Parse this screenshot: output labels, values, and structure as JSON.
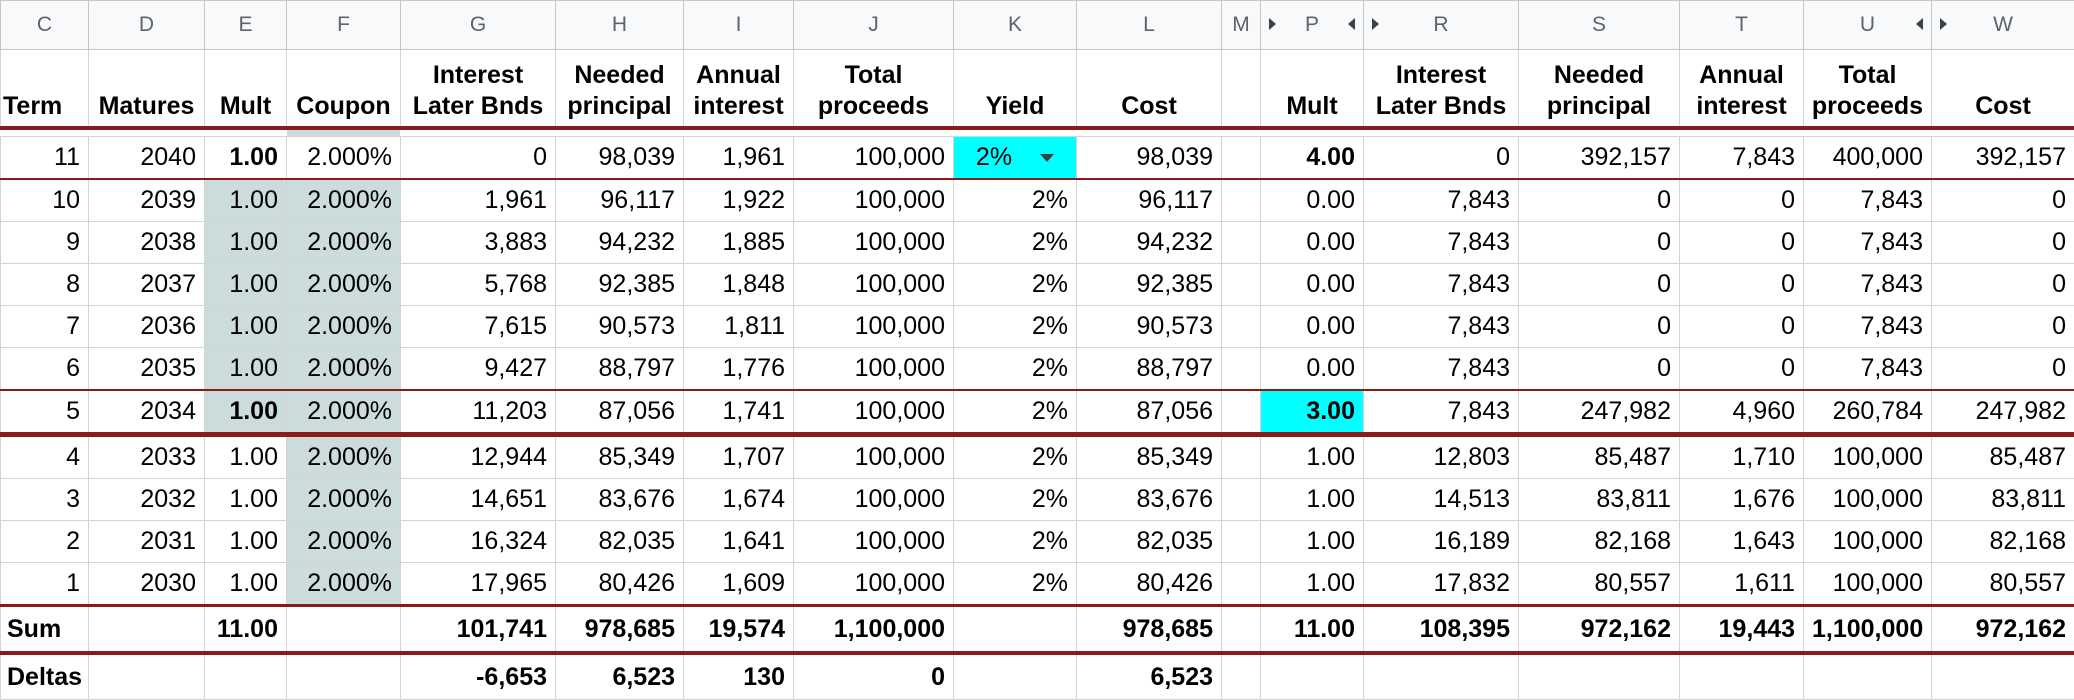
{
  "columns": [
    "C",
    "D",
    "E",
    "F",
    "G",
    "H",
    "I",
    "J",
    "K",
    "L",
    "M",
    "P",
    "R",
    "S",
    "T",
    "U",
    "W"
  ],
  "headers": {
    "term": "Term",
    "matures": "Matures",
    "mult": "Mult",
    "coupon": "Coupon",
    "interest_later": "Interest Later Bnds",
    "needed_principal": "Needed principal",
    "annual_interest": "Annual interest",
    "total_proceeds": "Total proceeds",
    "yield": "Yield",
    "cost": "Cost",
    "mult2": "Mult",
    "interest_later2": "Interest Later Bnds",
    "needed_principal2": "Needed principal",
    "annual_interest2": "Annual interest",
    "total_proceeds2": "Total proceeds",
    "cost2": "Cost"
  },
  "rows": [
    {
      "term": "11",
      "matures": "2040",
      "mult": "1.00",
      "coupon": "2.000%",
      "g": "0",
      "h": "98,039",
      "i": "1,961",
      "j": "100,000",
      "yield": "2%",
      "l": "98,039",
      "p": "4.00",
      "r": "0",
      "s": "392,157",
      "t": "7,843",
      "u": "400,000",
      "w": "392,157"
    },
    {
      "term": "10",
      "matures": "2039",
      "mult": "1.00",
      "coupon": "2.000%",
      "g": "1,961",
      "h": "96,117",
      "i": "1,922",
      "j": "100,000",
      "yield": "2%",
      "l": "96,117",
      "p": "0.00",
      "r": "7,843",
      "s": "0",
      "t": "0",
      "u": "7,843",
      "w": "0"
    },
    {
      "term": "9",
      "matures": "2038",
      "mult": "1.00",
      "coupon": "2.000%",
      "g": "3,883",
      "h": "94,232",
      "i": "1,885",
      "j": "100,000",
      "yield": "2%",
      "l": "94,232",
      "p": "0.00",
      "r": "7,843",
      "s": "0",
      "t": "0",
      "u": "7,843",
      "w": "0"
    },
    {
      "term": "8",
      "matures": "2037",
      "mult": "1.00",
      "coupon": "2.000%",
      "g": "5,768",
      "h": "92,385",
      "i": "1,848",
      "j": "100,000",
      "yield": "2%",
      "l": "92,385",
      "p": "0.00",
      "r": "7,843",
      "s": "0",
      "t": "0",
      "u": "7,843",
      "w": "0"
    },
    {
      "term": "7",
      "matures": "2036",
      "mult": "1.00",
      "coupon": "2.000%",
      "g": "7,615",
      "h": "90,573",
      "i": "1,811",
      "j": "100,000",
      "yield": "2%",
      "l": "90,573",
      "p": "0.00",
      "r": "7,843",
      "s": "0",
      "t": "0",
      "u": "7,843",
      "w": "0"
    },
    {
      "term": "6",
      "matures": "2035",
      "mult": "1.00",
      "coupon": "2.000%",
      "g": "9,427",
      "h": "88,797",
      "i": "1,776",
      "j": "100,000",
      "yield": "2%",
      "l": "88,797",
      "p": "0.00",
      "r": "7,843",
      "s": "0",
      "t": "0",
      "u": "7,843",
      "w": "0"
    },
    {
      "term": "5",
      "matures": "2034",
      "mult": "1.00",
      "coupon": "2.000%",
      "g": "11,203",
      "h": "87,056",
      "i": "1,741",
      "j": "100,000",
      "yield": "2%",
      "l": "87,056",
      "p": "3.00",
      "r": "7,843",
      "s": "247,982",
      "t": "4,960",
      "u": "260,784",
      "w": "247,982"
    },
    {
      "term": "4",
      "matures": "2033",
      "mult": "1.00",
      "coupon": "2.000%",
      "g": "12,944",
      "h": "85,349",
      "i": "1,707",
      "j": "100,000",
      "yield": "2%",
      "l": "85,349",
      "p": "1.00",
      "r": "12,803",
      "s": "85,487",
      "t": "1,710",
      "u": "100,000",
      "w": "85,487"
    },
    {
      "term": "3",
      "matures": "2032",
      "mult": "1.00",
      "coupon": "2.000%",
      "g": "14,651",
      "h": "83,676",
      "i": "1,674",
      "j": "100,000",
      "yield": "2%",
      "l": "83,676",
      "p": "1.00",
      "r": "14,513",
      "s": "83,811",
      "t": "1,676",
      "u": "100,000",
      "w": "83,811"
    },
    {
      "term": "2",
      "matures": "2031",
      "mult": "1.00",
      "coupon": "2.000%",
      "g": "16,324",
      "h": "82,035",
      "i": "1,641",
      "j": "100,000",
      "yield": "2%",
      "l": "82,035",
      "p": "1.00",
      "r": "16,189",
      "s": "82,168",
      "t": "1,643",
      "u": "100,000",
      "w": "82,168"
    },
    {
      "term": "1",
      "matures": "2030",
      "mult": "1.00",
      "coupon": "2.000%",
      "g": "17,965",
      "h": "80,426",
      "i": "1,609",
      "j": "100,000",
      "yield": "2%",
      "l": "80,426",
      "p": "1.00",
      "r": "17,832",
      "s": "80,557",
      "t": "1,611",
      "u": "100,000",
      "w": "80,557"
    }
  ],
  "sum": {
    "label": "Sum",
    "mult": "11.00",
    "g": "101,741",
    "h": "978,685",
    "i": "19,574",
    "j": "1,100,000",
    "l": "978,685",
    "p": "11.00",
    "r": "108,395",
    "s": "972,162",
    "t": "19,443",
    "u": "1,100,000",
    "w": "972,162"
  },
  "deltas": {
    "label": "Deltas",
    "g": "-6,653",
    "h": "6,523",
    "i": "130",
    "j": "0",
    "l": "6,523"
  },
  "colors": {
    "accent_cyan": "#00ffff",
    "shade": "#ccdcdc",
    "rule": "#8b1a1a"
  }
}
